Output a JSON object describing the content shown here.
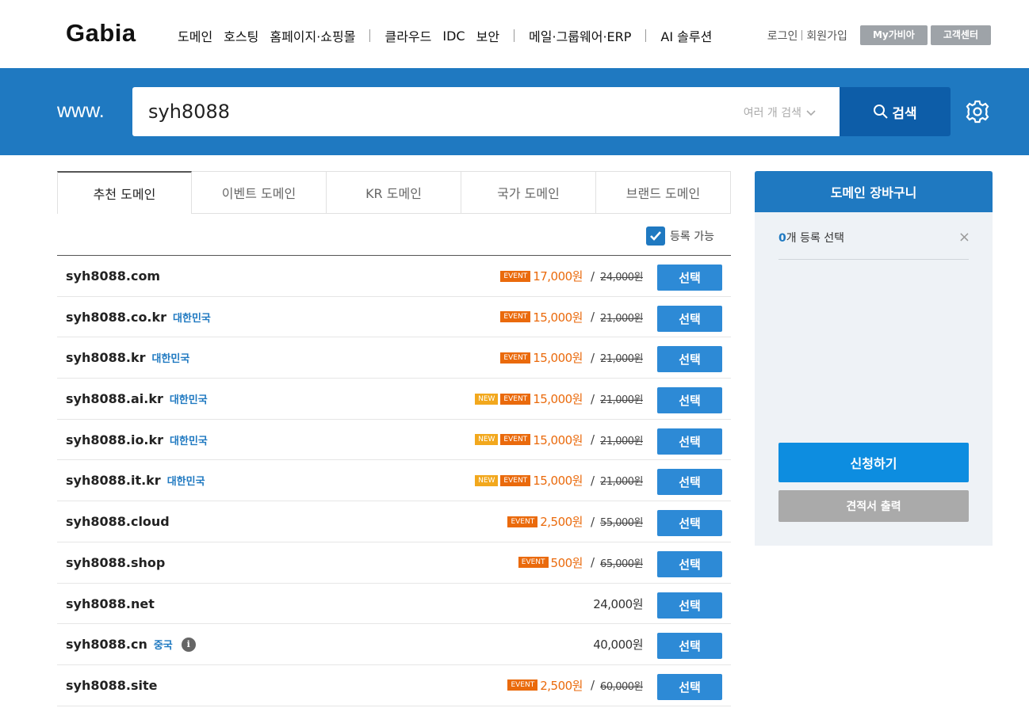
{
  "header": {
    "logo": "Gabia",
    "nav": [
      {
        "label": "도메인",
        "sep_after": false
      },
      {
        "label": "호스팅",
        "sep_after": false
      },
      {
        "label": "홈페이지·쇼핑몰",
        "sep_after": true
      },
      {
        "label": "클라우드",
        "sep_after": false
      },
      {
        "label": "IDC",
        "sep_after": false
      },
      {
        "label": "보안",
        "sep_after": true
      },
      {
        "label": "메일·그룹웨어·ERP",
        "sep_after": true
      },
      {
        "label": "AI 솔루션",
        "sep_after": false
      }
    ],
    "login": "로그인",
    "signup": "회원가입",
    "my_gabia": "My가비아",
    "customer_center": "고객센터"
  },
  "search": {
    "prefix": "www.",
    "value": "syh8088",
    "multi_search": "여러 개 검색",
    "button": "검색"
  },
  "tabs": [
    "추천 도메인",
    "이벤트 도메인",
    "KR 도메인",
    "국가 도메인",
    "브랜드 도메인"
  ],
  "filter": {
    "available_label": "등록 가능",
    "checked": true
  },
  "domains": [
    {
      "name": "syh8088.com",
      "country": "",
      "info": false,
      "badges": [
        "EVENT"
      ],
      "price": "17,000원",
      "original": "24,000원"
    },
    {
      "name": "syh8088.co.kr",
      "country": "대한민국",
      "info": false,
      "badges": [
        "EVENT"
      ],
      "price": "15,000원",
      "original": "21,000원"
    },
    {
      "name": "syh8088.kr",
      "country": "대한민국",
      "info": false,
      "badges": [
        "EVENT"
      ],
      "price": "15,000원",
      "original": "21,000원"
    },
    {
      "name": "syh8088.ai.kr",
      "country": "대한민국",
      "info": false,
      "badges": [
        "NEW",
        "EVENT"
      ],
      "price": "15,000원",
      "original": "21,000원"
    },
    {
      "name": "syh8088.io.kr",
      "country": "대한민국",
      "info": false,
      "badges": [
        "NEW",
        "EVENT"
      ],
      "price": "15,000원",
      "original": "21,000원"
    },
    {
      "name": "syh8088.it.kr",
      "country": "대한민국",
      "info": false,
      "badges": [
        "NEW",
        "EVENT"
      ],
      "price": "15,000원",
      "original": "21,000원"
    },
    {
      "name": "syh8088.cloud",
      "country": "",
      "info": false,
      "badges": [
        "EVENT"
      ],
      "price": "2,500원",
      "original": "55,000원"
    },
    {
      "name": "syh8088.shop",
      "country": "",
      "info": false,
      "badges": [
        "EVENT"
      ],
      "price": "500원",
      "original": "65,000원"
    },
    {
      "name": "syh8088.net",
      "country": "",
      "info": false,
      "badges": [],
      "price": "24,000원",
      "original": ""
    },
    {
      "name": "syh8088.cn",
      "country": "중국",
      "info": true,
      "badges": [],
      "price": "40,000원",
      "original": ""
    },
    {
      "name": "syh8088.site",
      "country": "",
      "info": false,
      "badges": [
        "EVENT"
      ],
      "price": "2,500원",
      "original": "60,000원"
    }
  ],
  "select_label": "선택",
  "cart": {
    "title": "도메인 장바구니",
    "count": "0",
    "count_suffix": "개 등록 선택",
    "close": "×",
    "apply": "신청하기",
    "quote": "견적서 출력"
  },
  "colors": {
    "primary": "#1f79c1",
    "search_button": "#0d5da8",
    "event": "#ea6a0c",
    "new": "#f2a81d",
    "select_button": "#2d8ad6"
  }
}
